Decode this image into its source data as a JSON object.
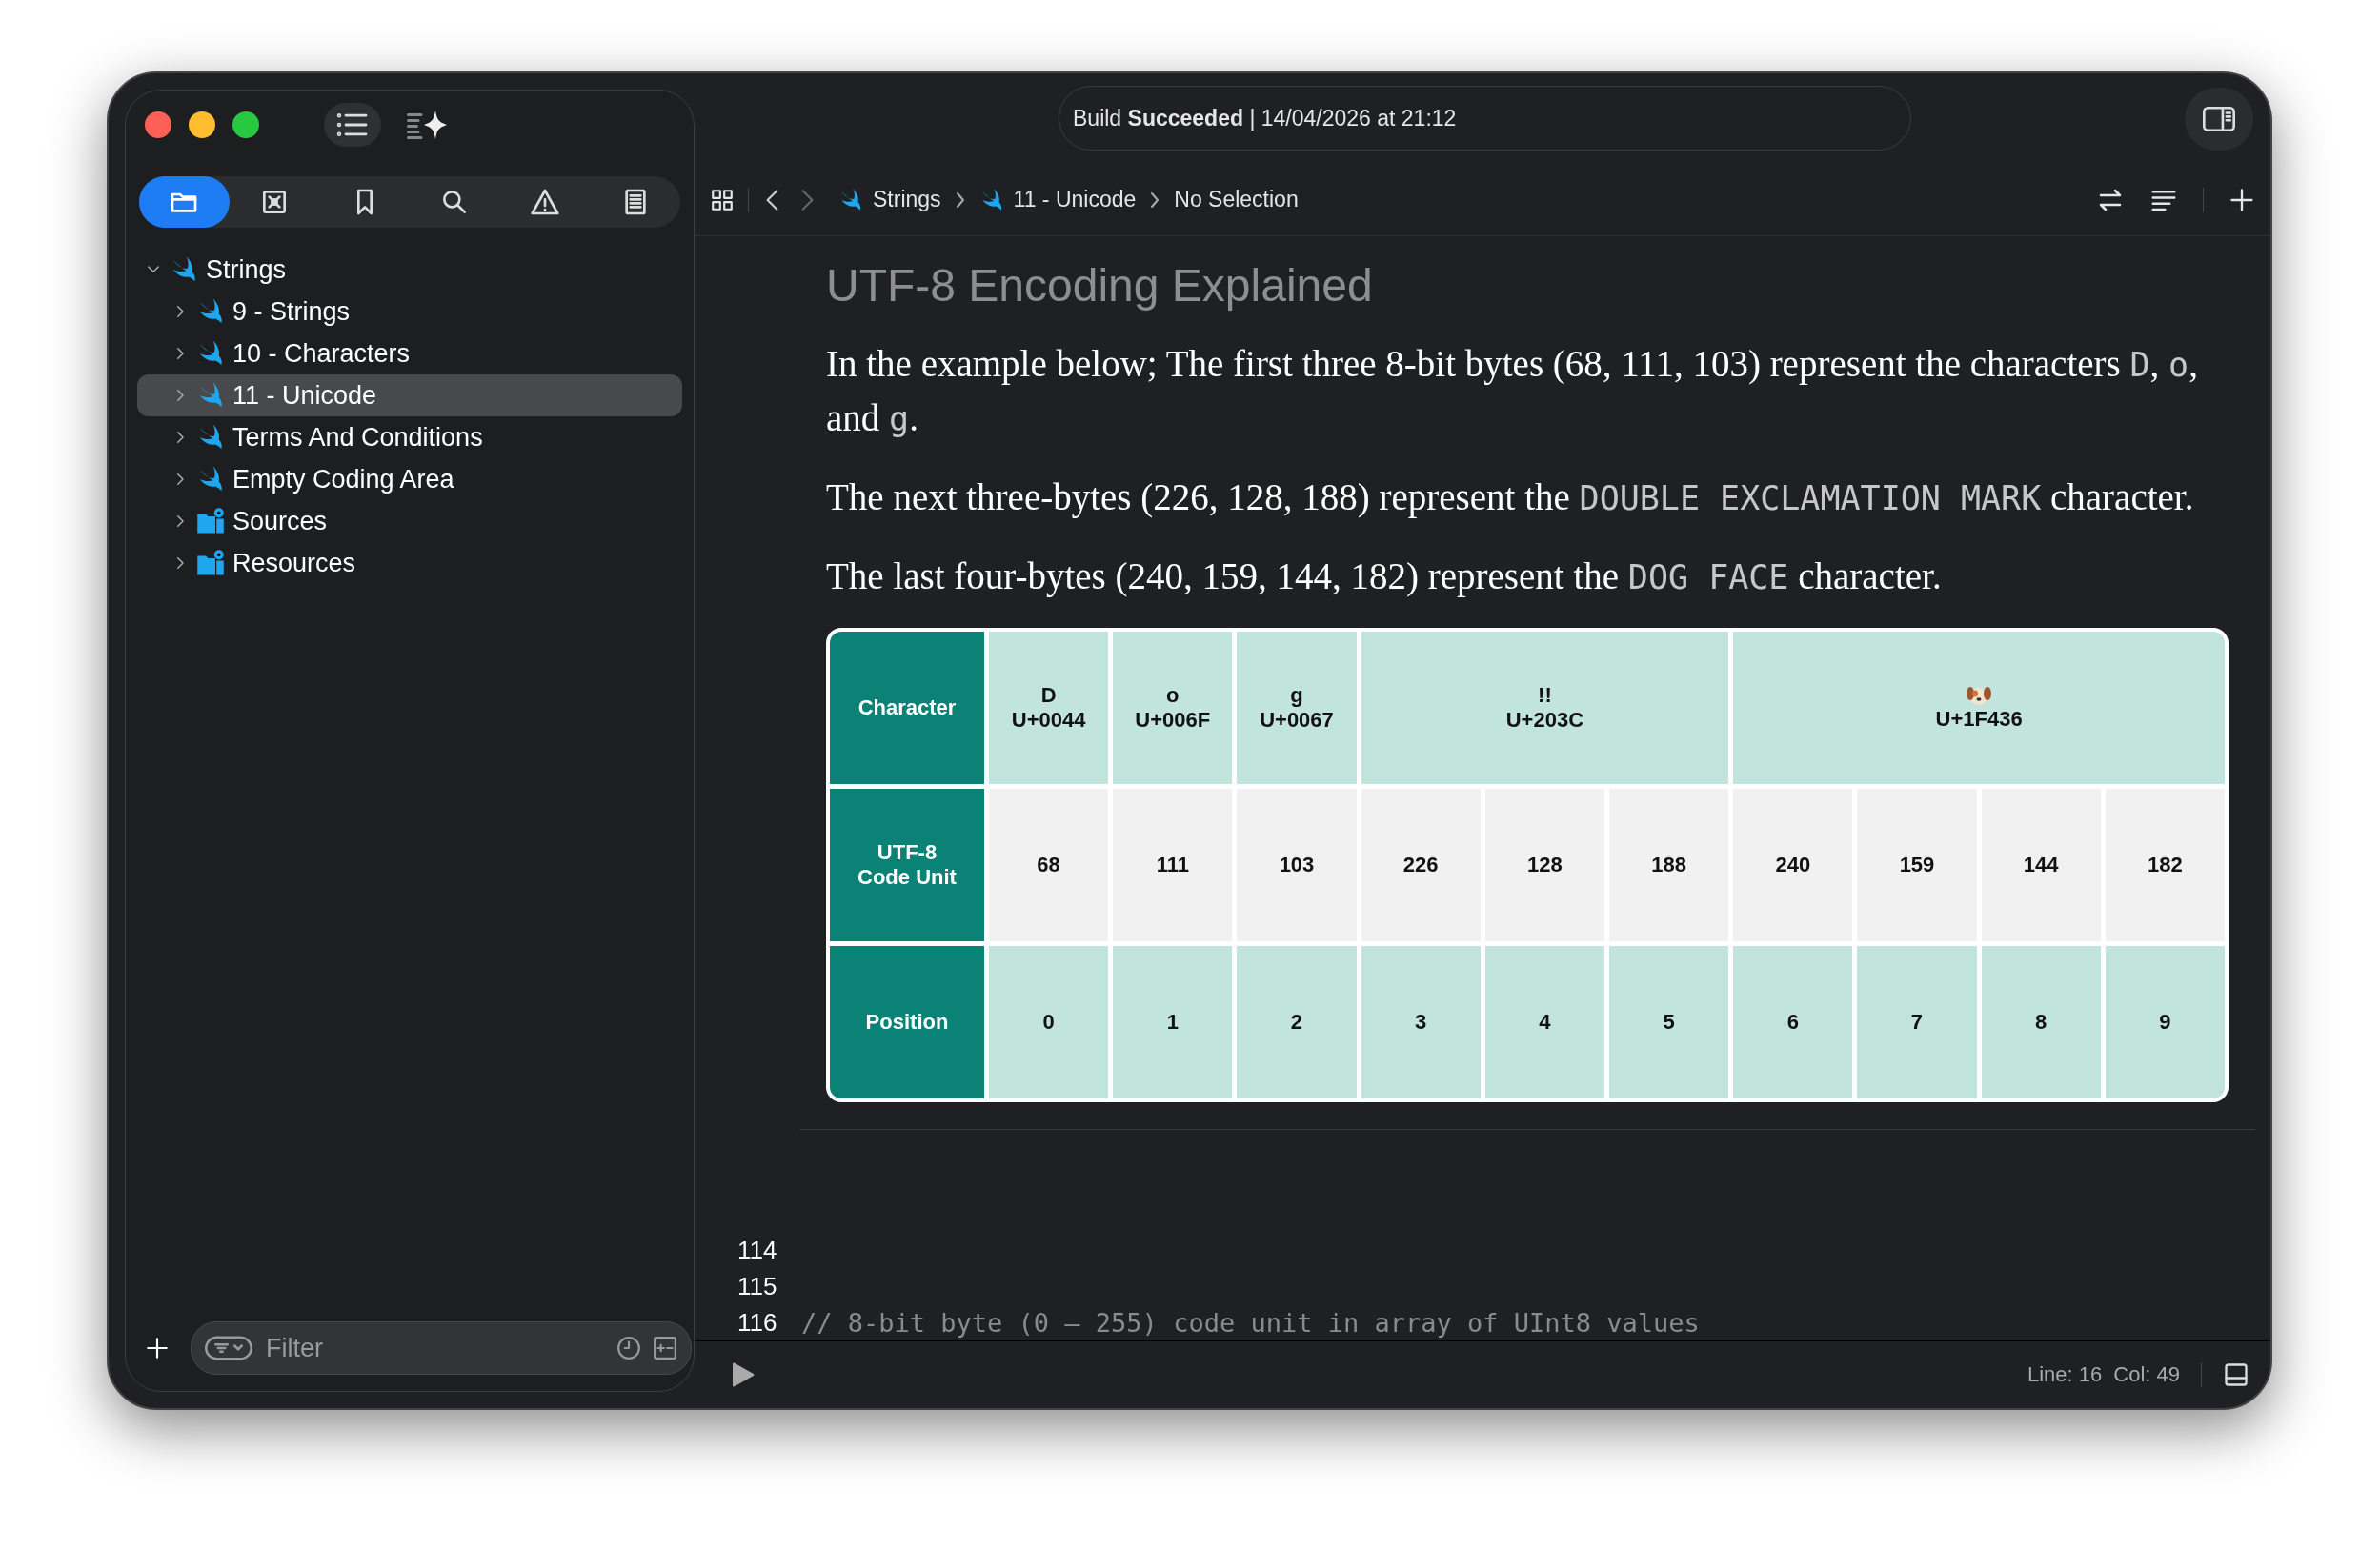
{
  "toolbar": {
    "status": "Build **Succeeded** | 14/04/2026 at 21:12"
  },
  "navigator_tabs": [
    {
      "selected": true
    },
    {
      "selected": false
    },
    {
      "selected": false
    },
    {
      "selected": false
    },
    {
      "selected": false
    },
    {
      "selected": false
    }
  ],
  "sidebar": {
    "tree": [
      {
        "label": "Strings",
        "kind": "swift",
        "expanded": true,
        "selected": false,
        "children": [
          {
            "label": "9 - Strings",
            "kind": "swift",
            "expanded": false,
            "selected": false
          },
          {
            "label": "10 - Characters",
            "kind": "swift",
            "expanded": false,
            "selected": false
          },
          {
            "label": "11 - Unicode",
            "kind": "swift",
            "expanded": false,
            "selected": true
          },
          {
            "label": "Terms And Conditions",
            "kind": "swift",
            "expanded": false,
            "selected": false
          },
          {
            "label": "Empty Coding Area",
            "kind": "swift",
            "expanded": false,
            "selected": false
          },
          {
            "label": "Sources",
            "kind": "folder",
            "expanded": false,
            "selected": false
          },
          {
            "label": "Resources",
            "kind": "folder",
            "expanded": false,
            "selected": false
          }
        ]
      }
    ]
  },
  "filter": {
    "placeholder": "Filter"
  },
  "breadcrumb": [
    {
      "label": "Strings",
      "kind": "swift"
    },
    {
      "label": "11 - Unicode",
      "kind": "swift"
    },
    {
      "label": "No Selection",
      "kind": "plain"
    }
  ],
  "document": {
    "title": "UTF-8 Encoding Explained",
    "paragraphs": [
      [
        {
          "kind": "text",
          "text": "In the example below; The first three 8-bit bytes (68, 111, 103) represent the characters "
        },
        {
          "kind": "code",
          "text": "D"
        },
        {
          "kind": "text",
          "text": ", "
        },
        {
          "kind": "code",
          "text": "o"
        },
        {
          "kind": "text",
          "text": ", and "
        },
        {
          "kind": "code",
          "text": "g"
        },
        {
          "kind": "text",
          "text": "."
        }
      ],
      [
        {
          "kind": "text",
          "text": "The next three-bytes (226, 128, 188) represent the "
        },
        {
          "kind": "code",
          "text": "DOUBLE EXCLAMATION MARK"
        },
        {
          "kind": "text",
          "text": " character."
        }
      ],
      [
        {
          "kind": "text",
          "text": "The last four-bytes (240, 159, 144, 182) represent the "
        },
        {
          "kind": "code",
          "text": "DOG FACE"
        },
        {
          "kind": "text",
          "text": " character."
        }
      ]
    ]
  },
  "table": {
    "row_headers": [
      "Character",
      "UTF-8\nCode Unit",
      "Position"
    ],
    "characters": [
      {
        "kind": "text",
        "char": "D",
        "code": "U+0044"
      },
      {
        "kind": "text",
        "char": "o",
        "code": "U+006F"
      },
      {
        "kind": "text",
        "char": "g",
        "code": "U+0067"
      },
      {
        "kind": "text",
        "char": "!!",
        "code": "U+203C"
      },
      {
        "kind": "emoji",
        "code": "U+1F436"
      }
    ],
    "code_units": [
      [
        "68"
      ],
      [
        "111"
      ],
      [
        "103"
      ],
      [
        "226",
        "128",
        "188"
      ],
      [
        "240",
        "159",
        "144",
        "182"
      ]
    ],
    "positions": [
      "0",
      "1",
      "2",
      "3",
      "4",
      "5",
      "6",
      "7",
      "8",
      "9"
    ]
  },
  "editor": {
    "lines": [
      {
        "number": "114"
      },
      {
        "number": "115"
      },
      {
        "number": "116",
        "text": "// 8-bit byte (0 – 255) code unit in array of UInt8 values"
      }
    ]
  },
  "status_bar": {
    "line": "Line: 16",
    "column": "Col: 49"
  }
}
